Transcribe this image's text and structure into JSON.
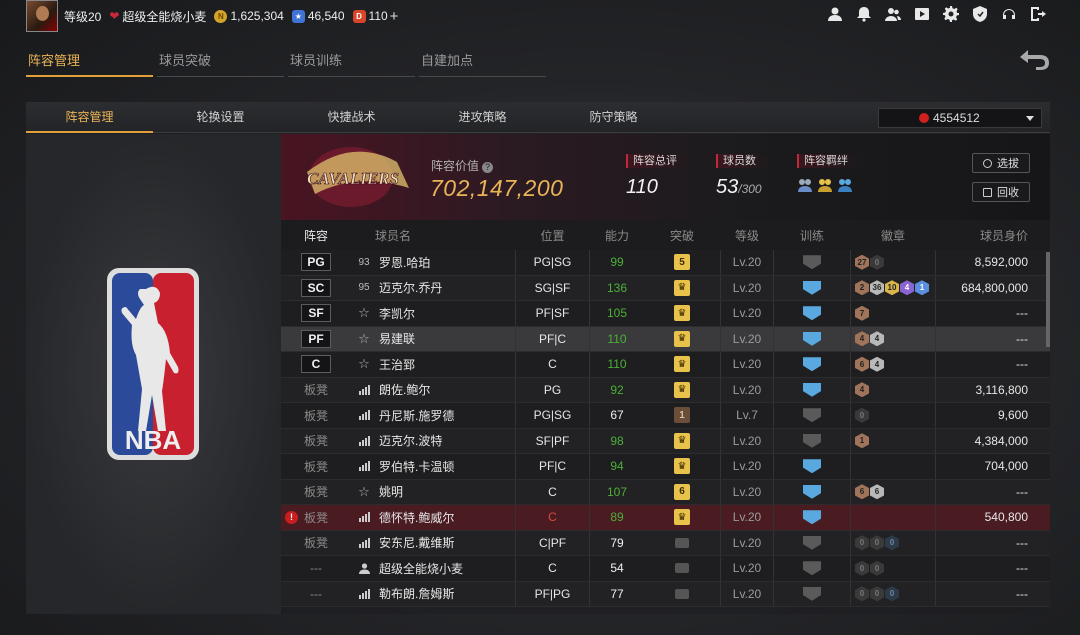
{
  "user": {
    "level": "等级20",
    "name": "超级全能烧小麦",
    "gold": "1,625,304",
    "stars": "46,540",
    "diamonds": "110",
    "coin_gold_glyph": "N",
    "coin_star_glyph": "★",
    "coin_diamond_glyph": "D"
  },
  "top_icons": [
    "profile-icon",
    "notification-icon",
    "friends-icon",
    "video-icon",
    "settings-icon",
    "shield-icon",
    "headset-icon",
    "logout-icon"
  ],
  "main_tabs": [
    "阵容管理",
    "球员突破",
    "球员训练",
    "自建加点"
  ],
  "sub_tabs": [
    "阵容管理",
    "轮换设置",
    "快捷战术",
    "进攻策略",
    "防守策略"
  ],
  "team_select": "4554512",
  "team": {
    "value_label": "阵容价值",
    "value_help": "?",
    "value": "702,147,200",
    "rating_label": "阵容总评",
    "rating": "110",
    "count_label": "球员数",
    "count": "53",
    "count_max": "/300",
    "synergy_label": "阵容羁绊",
    "filter_button": "选拔",
    "recycle_button": "回收"
  },
  "columns": [
    "阵容",
    "球员名",
    "位置",
    "能力",
    "突破",
    "等级",
    "训练",
    "徽章",
    "球员身价"
  ],
  "rows": [
    {
      "slot": "PG",
      "icon": "93",
      "name": "罗恩.哈珀",
      "pos": "PG|SG",
      "ability": "99",
      "brk": "5",
      "level": "Lv.20",
      "value": "8,592,000"
    },
    {
      "slot": "SC",
      "icon": "95",
      "name": "迈克尔.乔丹",
      "pos": "SG|SF",
      "ability": "136",
      "brk": "",
      "level": "Lv.20",
      "value": "684,800,000"
    },
    {
      "slot": "SF",
      "icon": "☆",
      "name": "李凯尔",
      "pos": "PF|SF",
      "ability": "105",
      "brk": "",
      "level": "Lv.20",
      "value": "---"
    },
    {
      "slot": "PF",
      "icon": "☆",
      "name": "易建联",
      "pos": "PF|C",
      "ability": "110",
      "brk": "",
      "level": "Lv.20",
      "value": "---"
    },
    {
      "slot": "C",
      "icon": "☆",
      "name": "王治郅",
      "pos": "C",
      "ability": "110",
      "brk": "",
      "level": "Lv.20",
      "value": "---"
    },
    {
      "slot": "板凳",
      "icon": "",
      "name": "朗佐.鲍尔",
      "pos": "PG",
      "ability": "92",
      "brk": "",
      "level": "Lv.20",
      "value": "3,116,800"
    },
    {
      "slot": "板凳",
      "icon": "",
      "name": "丹尼斯.施罗德",
      "pos": "PG|SG",
      "ability": "67",
      "brk": "1",
      "level": "Lv.7",
      "value": "9,600"
    },
    {
      "slot": "板凳",
      "icon": "",
      "name": "迈克尔.波特",
      "pos": "SF|PF",
      "ability": "98",
      "brk": "",
      "level": "Lv.20",
      "value": "4,384,000"
    },
    {
      "slot": "板凳",
      "icon": "",
      "name": "罗伯特.卡温顿",
      "pos": "PF|C",
      "ability": "94",
      "brk": "",
      "level": "Lv.20",
      "value": "704,000"
    },
    {
      "slot": "板凳",
      "icon": "☆",
      "name": "姚明",
      "pos": "C",
      "ability": "107",
      "brk": "6",
      "level": "Lv.20",
      "value": "---"
    },
    {
      "slot": "板凳",
      "icon": "",
      "name": "德怀特.鲍威尔",
      "pos": "C",
      "ability": "89",
      "brk": "",
      "level": "Lv.20",
      "value": "540,800"
    },
    {
      "slot": "板凳",
      "icon": "",
      "name": "安东尼.戴维斯",
      "pos": "C|PF",
      "ability": "79",
      "brk": "",
      "level": "Lv.20",
      "value": "---"
    },
    {
      "slot": "---",
      "icon": "",
      "name": "超级全能烧小麦",
      "pos": "C",
      "ability": "54",
      "brk": "",
      "level": "Lv.20",
      "value": "---"
    },
    {
      "slot": "---",
      "icon": "",
      "name": "勒布朗.詹姆斯",
      "pos": "PF|PG",
      "ability": "77",
      "brk": "",
      "level": "Lv.20",
      "value": "---"
    }
  ],
  "badges": {
    "r0": [
      "27",
      "0"
    ],
    "r1": [
      "2",
      "36",
      "10",
      "4",
      "1"
    ],
    "r2": [
      "7"
    ],
    "r3": [
      "4",
      "4"
    ],
    "r4": [
      "6",
      "4"
    ],
    "r5": [
      "4"
    ],
    "r6": [
      "0"
    ],
    "r7": [
      "1"
    ],
    "r9": [
      "6",
      "6"
    ],
    "r11": [
      "0",
      "0",
      "0"
    ],
    "r12": [
      "0",
      "0"
    ],
    "r13": [
      "0",
      "0",
      "0"
    ]
  },
  "logo_text": "CAVALIERS",
  "nba_text": "NBA",
  "warn_mark": "!",
  "colors": {
    "accent": "#e9b458",
    "green": "#4caf38",
    "red": "#d94a3a"
  }
}
